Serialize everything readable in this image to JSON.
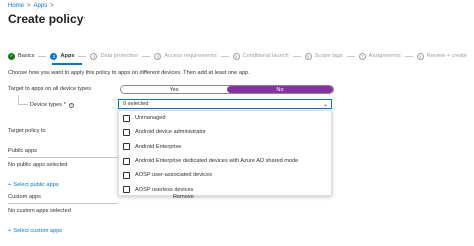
{
  "breadcrumb": {
    "home": "Home",
    "sep": ">",
    "apps": "Apps",
    "sep2": ">"
  },
  "page": {
    "title": "Create policy",
    "menu": "···"
  },
  "steps": [
    {
      "num": "✓",
      "label": "Basics",
      "state": "done"
    },
    {
      "num": "2",
      "label": "Apps",
      "state": "active"
    },
    {
      "num": "3",
      "label": "Data protection",
      "state": "pending"
    },
    {
      "num": "4",
      "label": "Access requirements",
      "state": "pending"
    },
    {
      "num": "5",
      "label": "Conditional launch",
      "state": "pending"
    },
    {
      "num": "6",
      "label": "Scope tags",
      "state": "pending"
    },
    {
      "num": "7",
      "label": "Assignments",
      "state": "pending"
    },
    {
      "num": "8",
      "label": "Review + create",
      "state": "pending"
    }
  ],
  "intro": "Choose how you want to apply this policy to apps on different devices. Then add at least one app.",
  "target_all": {
    "label": "Target to apps on all device types",
    "info": "i",
    "yes": "Yes",
    "no": "No",
    "selected": "No"
  },
  "device_types": {
    "label": "Device types *",
    "info": "i",
    "value": "0 selected",
    "chevron": "⌄"
  },
  "dropdown_options": [
    "Unmanaged",
    "Android device administrator",
    "Android Enterprise",
    "Android Enterprise dedicated devices with Azure AD shared mode",
    "AOSP user-associated devices",
    "AOSP userless devices"
  ],
  "target_policy": {
    "label": "Target policy to"
  },
  "public_apps": {
    "header": "Public apps",
    "empty": "No public apps selected",
    "link": "Select public apps"
  },
  "custom_apps": {
    "header": "Custom apps",
    "empty": "No custom apps selected",
    "link": "Select custom apps",
    "remove_col": "Remove"
  },
  "colors": {
    "accent": "#0078d4",
    "toggle_on": "#8a2ea8",
    "done": "#107c10"
  }
}
